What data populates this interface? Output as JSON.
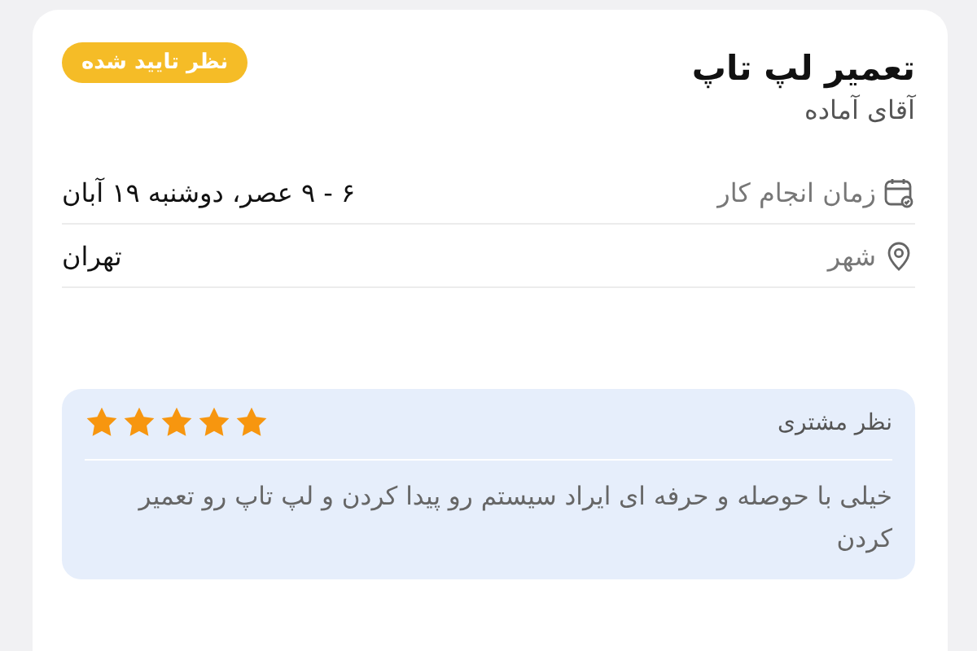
{
  "title": "تعمیر لپ تاپ",
  "badge": "نظر تایید شده",
  "provider": "آقای آماده",
  "details": [
    {
      "kind": "calendar",
      "label": "زمان انجام کار",
      "value": "۶ - ۹ عصر، دوشنبه ۱۹ آبان"
    },
    {
      "kind": "location",
      "label": "شهر",
      "value": "تهران"
    }
  ],
  "review": {
    "title": "نظر مشتری",
    "stars": 5,
    "text": "خیلی با حوصله و حرفه ای ایراد سیستم رو پیدا کردن و لپ تاپ رو تعمیر کردن"
  }
}
